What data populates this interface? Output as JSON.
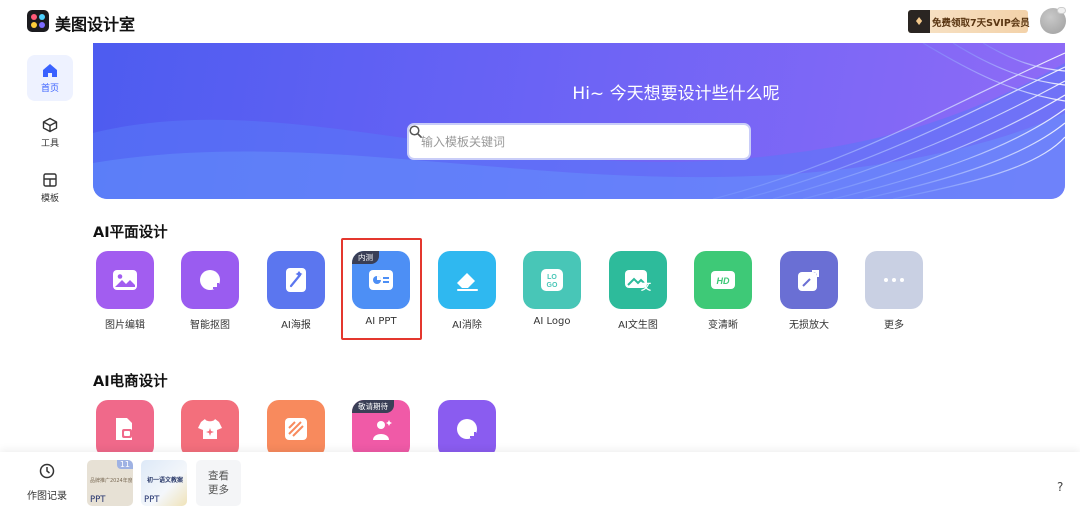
{
  "header": {
    "app_title": "美图设计室",
    "vip_label": "免费领取7天SVIP会员"
  },
  "sidebar": {
    "items": [
      {
        "label": "首页",
        "icon": "home-icon",
        "active": true
      },
      {
        "label": "工具",
        "icon": "box-icon",
        "active": false
      },
      {
        "label": "模板",
        "icon": "template-icon",
        "active": false
      }
    ]
  },
  "banner": {
    "greeting": "Hi~ 今天想要设计些什么呢",
    "search_placeholder": "输入模板关键词"
  },
  "sections": [
    {
      "title": "AI平面设计",
      "tools": [
        {
          "label": "图片编辑",
          "icon": "image-icon",
          "color": "#a25df0",
          "badge": ""
        },
        {
          "label": "智能抠图",
          "icon": "cutout-icon",
          "color": "#9a5cf0",
          "badge": ""
        },
        {
          "label": "AI海报",
          "icon": "poster-icon",
          "color": "#5b76ef",
          "badge": ""
        },
        {
          "label": "AI PPT",
          "icon": "ppt-icon",
          "color": "#4d8ff5",
          "badge": "内测"
        },
        {
          "label": "AI消除",
          "icon": "eraser-icon",
          "color": "#2fb8f0",
          "badge": ""
        },
        {
          "label": "AI Logo",
          "icon": "logo-icon",
          "color": "#48c6b7",
          "badge": ""
        },
        {
          "label": "AI文生图",
          "icon": "text-to-image-icon",
          "color": "#2dbb9b",
          "badge": ""
        },
        {
          "label": "变清晰",
          "icon": "hd-icon",
          "color": "#3ec977",
          "badge": ""
        },
        {
          "label": "无损放大",
          "icon": "enlarge-icon",
          "color": "#6a6fd4",
          "badge": ""
        },
        {
          "label": "更多",
          "icon": "more-icon",
          "color": "#c9d0e3",
          "badge": ""
        }
      ]
    },
    {
      "title": "AI电商设计",
      "tools": [
        {
          "label": "",
          "icon": "product-icon",
          "color": "#f0698a",
          "badge": ""
        },
        {
          "label": "",
          "icon": "clothing-icon",
          "color": "#f36f7c",
          "badge": ""
        },
        {
          "label": "",
          "icon": "pattern-icon",
          "color": "#f88a5d",
          "badge": ""
        },
        {
          "label": "",
          "icon": "model-icon",
          "color": "#f05aa7",
          "badge": "敬请期待"
        },
        {
          "label": "",
          "icon": "cutout-icon",
          "color": "#8a5cf0",
          "badge": ""
        }
      ]
    }
  ],
  "bottom": {
    "history_label": "作图记录",
    "thumbs": [
      {
        "tag": "PPT",
        "count": "11",
        "caption": "品牌推广2024年度总结方案"
      },
      {
        "tag": "PPT",
        "count": "",
        "caption": "初一语文教案"
      }
    ],
    "view_more": "查看更多",
    "help": "?"
  }
}
